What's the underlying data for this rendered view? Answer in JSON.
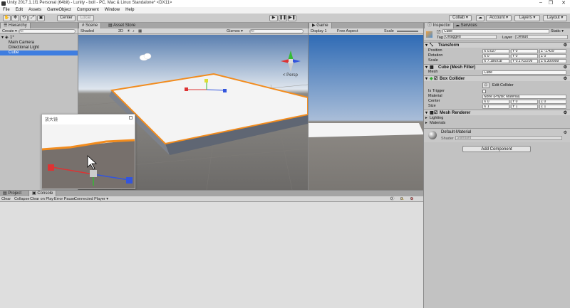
{
  "titlebar": {
    "title": "Unity 2017.1.1f1 Personal (64bit) - Lunity - boll - PC, Mac & Linux Standalone* <DX11>",
    "minimize": "–",
    "maximize": "❐",
    "close": "✕"
  },
  "menu": [
    "File",
    "Edit",
    "Assets",
    "GameObject",
    "Component",
    "Window",
    "Help"
  ],
  "toolbar": {
    "center": "Center",
    "local": "Local",
    "collab": "Collab ▾",
    "account": "Account ▾",
    "layers": "Layers ▾",
    "layout": "Layout ▾"
  },
  "hierarchy": {
    "tab": "Hierarchy",
    "create": "Create ▾",
    "search_placeholder": "All",
    "scene": "1*",
    "items": [
      "Main Camera",
      "Directional Light",
      "Cube"
    ],
    "selected_index": 2
  },
  "scene": {
    "tab": "Scene",
    "tab2": "Asset Store",
    "shading": "Shaded",
    "mode2d": "2D",
    "gizmos": "Gizmos ▾",
    "search_placeholder": "All"
  },
  "game": {
    "tab": "Game",
    "display": "Display 1",
    "aspect": "Free Aspect",
    "scale": "Scale"
  },
  "magnifier": {
    "title": "放大镜"
  },
  "bottom": {
    "tab_project": "Project",
    "tab_console": "Console",
    "buttons": [
      "Clear",
      "Collapse",
      "Clear on Play",
      "Error Pause",
      "Connected Player ▾"
    ],
    "counts": [
      "0",
      "0",
      "0"
    ]
  },
  "inspector": {
    "tab": "Inspector",
    "tab2": "Services",
    "object_name": "Cube",
    "static": "Static ▾",
    "tag_label": "Tag",
    "tag_value": "Untagged",
    "layer_label": "Layer",
    "layer_value": "Default",
    "transform": {
      "title": "Transform",
      "rows": [
        {
          "label": "Position",
          "x": "0.027",
          "y": "0",
          "z": "-1.429"
        },
        {
          "label": "Rotation",
          "x": "0",
          "y": "0",
          "z": "0"
        },
        {
          "label": "Scale",
          "x": "7.186918",
          "y": "0.1702209",
          "z": "6.300999"
        }
      ]
    },
    "mesh_filter": {
      "title": "Cube (Mesh Filter)",
      "mesh_label": "Mesh",
      "mesh_value": "Cube"
    },
    "box_collider": {
      "title": "Box Collider",
      "edit_collider": "Edit Collider",
      "is_trigger": "Is Trigger",
      "material_label": "Material",
      "material_value": "None (Physic Material)",
      "center_label": "Center",
      "center": {
        "x": "0",
        "y": "0",
        "z": "0"
      },
      "size_label": "Size",
      "size": {
        "x": "1",
        "y": "1",
        "z": "1"
      }
    },
    "mesh_renderer": {
      "title": "Mesh Renderer",
      "lighting": "Lighting",
      "materials": "Materials"
    },
    "material": {
      "name": "Default-Material",
      "shader_label": "Shader",
      "shader_value": "Standard"
    },
    "add_component": "Add Component"
  },
  "colors": {
    "selection": "#3e7de0",
    "plane_outline": "#f28c1e",
    "sky_top": "#2f6bb5"
  }
}
